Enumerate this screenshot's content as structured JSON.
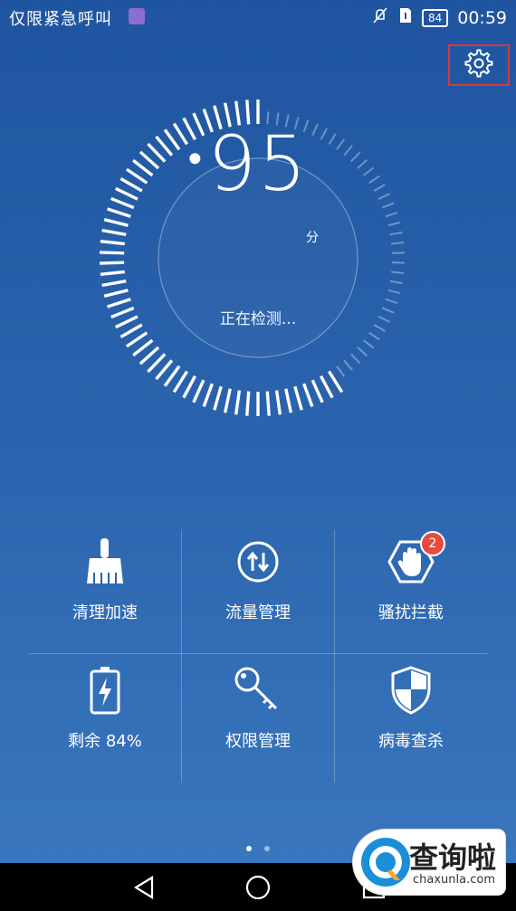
{
  "status_bar": {
    "carrier_text": "仅限紧急呼叫",
    "battery": "84",
    "time": "00:59"
  },
  "gauge": {
    "score": "95",
    "unit": "分",
    "status": "正在检测...",
    "progress": 0.6
  },
  "tools": [
    {
      "label": "清理加速",
      "icon": "broom-icon"
    },
    {
      "label": "流量管理",
      "icon": "data-arrows-icon"
    },
    {
      "label": "骚扰拦截",
      "icon": "hand-block-icon",
      "badge": "2"
    },
    {
      "label": "剩余 84%",
      "icon": "battery-charge-icon"
    },
    {
      "label": "权限管理",
      "icon": "key-icon"
    },
    {
      "label": "病毒查杀",
      "icon": "shield-icon"
    }
  ],
  "pager": {
    "pages": 2,
    "active": 0
  },
  "watermark": {
    "title": "查询啦",
    "subtitle": "chaxunla.com"
  },
  "colors": {
    "accent_red": "#d9383a",
    "badge_red": "#e74b3c"
  }
}
